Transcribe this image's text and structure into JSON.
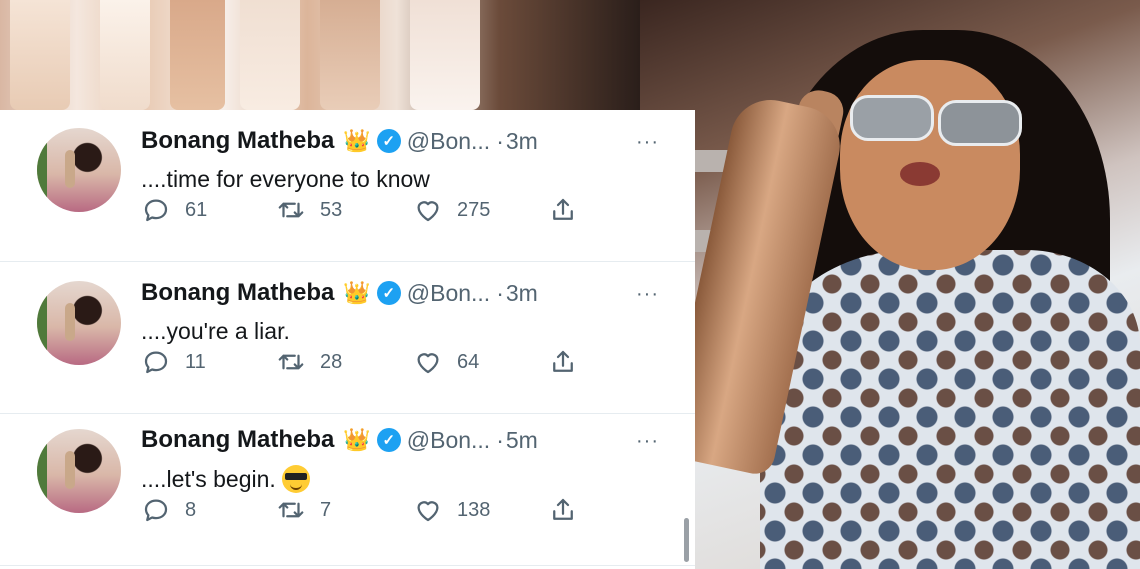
{
  "tweets": [
    {
      "author_name": "Bonang Matheba",
      "crown": "👑",
      "verified_mark": "✓",
      "handle": "@Bon...",
      "dot": "·",
      "time": "3m",
      "more": "···",
      "text": "....time for everyone to know",
      "replies": "61",
      "retweets": "53",
      "likes": "275"
    },
    {
      "author_name": "Bonang Matheba",
      "crown": "👑",
      "verified_mark": "✓",
      "handle": "@Bon...",
      "dot": "·",
      "time": "3m",
      "more": "···",
      "text": "....you're a liar.",
      "replies": "11",
      "retweets": "28",
      "likes": "64"
    },
    {
      "author_name": "Bonang Matheba",
      "crown": "👑",
      "verified_mark": "✓",
      "handle": "@Bon...",
      "dot": "·",
      "time": "5m",
      "more": "···",
      "text": "....let's begin.",
      "emoji": "sunglasses-emoji",
      "replies": "8",
      "retweets": "7",
      "likes": "138"
    }
  ],
  "icons": {
    "reply": "reply-icon",
    "retweet": "retweet-icon",
    "like": "heart-icon",
    "share": "share-icon"
  },
  "colors": {
    "verified": "#1da1f2",
    "text": "#14171a",
    "muted": "#536471"
  }
}
